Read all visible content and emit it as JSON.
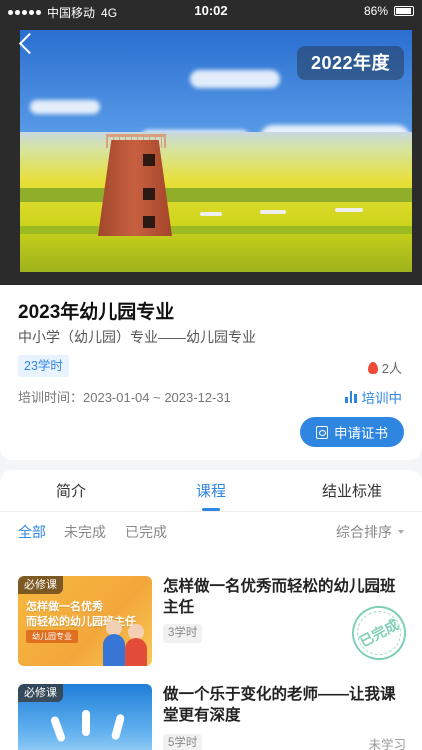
{
  "status_bar": {
    "carrier": "中国移动",
    "network": "4G",
    "time": "10:02",
    "battery": "86%"
  },
  "hero": {
    "year_badge": "2022年度"
  },
  "course": {
    "title": "2023年幼儿园专业",
    "subtitle": "中小学（幼儿园）专业——幼儿园专业",
    "hours": "23学时",
    "people": "2人",
    "time_label": "培训时间：",
    "time_range": "2023-01-04 ~ 2023-12-31",
    "status": "培训中",
    "apply_button": "申请证书"
  },
  "tabs": [
    "简介",
    "课程",
    "结业标准"
  ],
  "active_tab": "课程",
  "filters": [
    "全部",
    "未完成",
    "已完成"
  ],
  "sort_label": "综合排序",
  "courses": [
    {
      "tag": "必修课",
      "thumb_line1": "怎样做一名优秀",
      "thumb_line2": "而轻松的幼儿园班主任",
      "thumb_chip": "幼儿园专业",
      "title": "怎样做一名优秀而轻松的幼儿园班主任",
      "hours": "3学时",
      "status": "已完成"
    },
    {
      "tag": "必修课",
      "title": "做一个乐于变化的老师——让我课堂更有深度",
      "hours": "5学时",
      "status": "未学习"
    }
  ],
  "colors": {
    "accent": "#2f86e0",
    "stamp": "#7fd0b5"
  }
}
